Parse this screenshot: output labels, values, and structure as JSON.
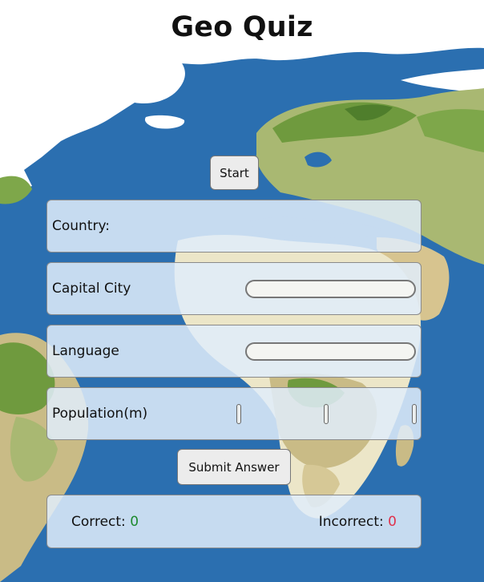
{
  "app": {
    "title": "Geo Quiz"
  },
  "controls": {
    "start_label": "Start",
    "submit_label": "Submit Answer"
  },
  "quiz": {
    "country_label": "Country:",
    "capital_label": "Capital City",
    "capital_value": "",
    "language_label": "Language",
    "language_value": "",
    "population_label": "Population(m)",
    "population_slider_count": 3
  },
  "score": {
    "correct_label": "Correct:",
    "correct_value": "0",
    "incorrect_label": "Incorrect:",
    "incorrect_value": "0"
  },
  "colors": {
    "ocean": "#2b6fb0",
    "correct": "#1d8a2e",
    "incorrect": "#e0314b",
    "panel": "#e0ecfa"
  }
}
